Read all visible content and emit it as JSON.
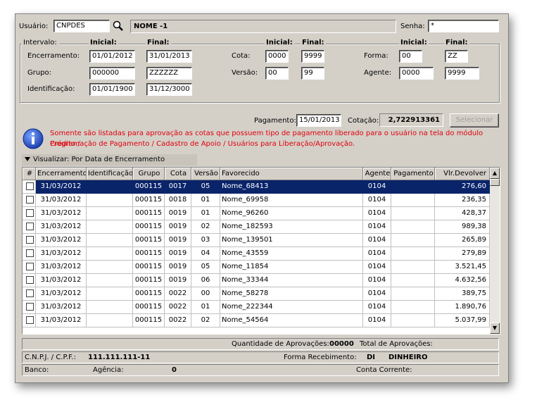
{
  "header": {
    "usuario_label": "Usuário:",
    "usuario_value": "CNPDES",
    "search_icon": "magnifier-icon",
    "usuario_name": "NOME -1",
    "senha_label": "Senha:",
    "senha_value": "*"
  },
  "intervalo": {
    "legend": "Intervalo:",
    "col1": {
      "inicial": "Inicial:",
      "final": "Final:"
    },
    "col2": {
      "inicial": "Inicial:",
      "final": "Final:"
    },
    "col3": {
      "inicial": "Inicial:",
      "final": "Final:"
    },
    "encerramento": {
      "label": "Encerramento:",
      "inicial": "01/01/2012",
      "final": "31/01/2013"
    },
    "grupo": {
      "label": "Grupo:",
      "inicial": "000000",
      "final": "ZZZZZZ"
    },
    "identificacao": {
      "label": "Identificação:",
      "inicial": "01/01/1900",
      "final": "31/12/3000"
    },
    "cota": {
      "label": "Cota:",
      "inicial": "0000",
      "final": "9999"
    },
    "versao": {
      "label": "Versão:",
      "inicial": "00",
      "final": "99"
    },
    "forma": {
      "label": "Forma:",
      "inicial": "00",
      "final": "ZZ"
    },
    "agente": {
      "label": "Agente:",
      "inicial": "0000",
      "final": "9999"
    }
  },
  "pagamento": {
    "label": "Pagamento:",
    "value": "15/01/2013",
    "cotacao_label": "Cotação:",
    "cotacao_value": "2,722913361",
    "selecionar_button": "Selecionar"
  },
  "info": {
    "icon": "info-icon",
    "line1": "Somente são listadas para aprovação as cotas que possuem tipo de pagamento liberado para o usuário na tela do módulo Crédito /",
    "line2": "Programação de Pagamento / Cadastro de Apoio / Usuários para Liberação/Aprovação."
  },
  "visualizar": {
    "label": "Visualizar: Por Data de Encerramento"
  },
  "grid": {
    "columns": [
      "#",
      "Encerramento",
      "Identificação",
      "Grupo",
      "Cota",
      "Versão",
      "Favorecido",
      "Agente",
      "Pagamento",
      "Vlr.Devolver"
    ],
    "rows": [
      {
        "enc": "31/03/2012",
        "ident": "",
        "grupo": "000115",
        "cota": "0017",
        "versao": "05",
        "fav": "Nome_68413",
        "agente": "0104",
        "pag": "",
        "vlr": "276,60",
        "selected": true
      },
      {
        "enc": "31/03/2012",
        "ident": "",
        "grupo": "000115",
        "cota": "0018",
        "versao": "01",
        "fav": "Nome_69958",
        "agente": "0104",
        "pag": "",
        "vlr": "236,35"
      },
      {
        "enc": "31/03/2012",
        "ident": "",
        "grupo": "000115",
        "cota": "0019",
        "versao": "01",
        "fav": "Nome_96260",
        "agente": "0104",
        "pag": "",
        "vlr": "428,37"
      },
      {
        "enc": "31/03/2012",
        "ident": "",
        "grupo": "000115",
        "cota": "0019",
        "versao": "02",
        "fav": "Nome_182593",
        "agente": "0104",
        "pag": "",
        "vlr": "989,38"
      },
      {
        "enc": "31/03/2012",
        "ident": "",
        "grupo": "000115",
        "cota": "0019",
        "versao": "03",
        "fav": "Nome_139501",
        "agente": "0104",
        "pag": "",
        "vlr": "265,89"
      },
      {
        "enc": "31/03/2012",
        "ident": "",
        "grupo": "000115",
        "cota": "0019",
        "versao": "04",
        "fav": "Nome_43559",
        "agente": "0104",
        "pag": "",
        "vlr": "279,89"
      },
      {
        "enc": "31/03/2012",
        "ident": "",
        "grupo": "000115",
        "cota": "0019",
        "versao": "05",
        "fav": "Nome_11854",
        "agente": "0104",
        "pag": "",
        "vlr": "3.521,45"
      },
      {
        "enc": "31/03/2012",
        "ident": "",
        "grupo": "000115",
        "cota": "0019",
        "versao": "06",
        "fav": "Nome_33344",
        "agente": "0104",
        "pag": "",
        "vlr": "4.632,56"
      },
      {
        "enc": "31/03/2012",
        "ident": "",
        "grupo": "000115",
        "cota": "0022",
        "versao": "00",
        "fav": "Nome_58278",
        "agente": "0104",
        "pag": "",
        "vlr": "389,75"
      },
      {
        "enc": "31/03/2012",
        "ident": "",
        "grupo": "000115",
        "cota": "0022",
        "versao": "01",
        "fav": "Nome_222344",
        "agente": "0104",
        "pag": "",
        "vlr": "1.890,76"
      },
      {
        "enc": "31/03/2012",
        "ident": "",
        "grupo": "000115",
        "cota": "0022",
        "versao": "02",
        "fav": "Nome_54564",
        "agente": "0104",
        "pag": "",
        "vlr": "5.037,99"
      }
    ]
  },
  "footer": {
    "qtd_label": "Quantidade de Aprovações:",
    "qtd_value": "00000",
    "total_label": "Total de Aprovações:",
    "cnpj_label": "C.N.P.J. / C.P.F.:",
    "cnpj_value": "111.111.111-11",
    "forma_label": "Forma Recebimento:",
    "forma_code": "DI",
    "forma_desc": "DINHEIRO",
    "banco_label": "Banco:",
    "agencia_label": "Agência:",
    "agencia_value": "0",
    "conta_label": "Conta Corrente:"
  }
}
